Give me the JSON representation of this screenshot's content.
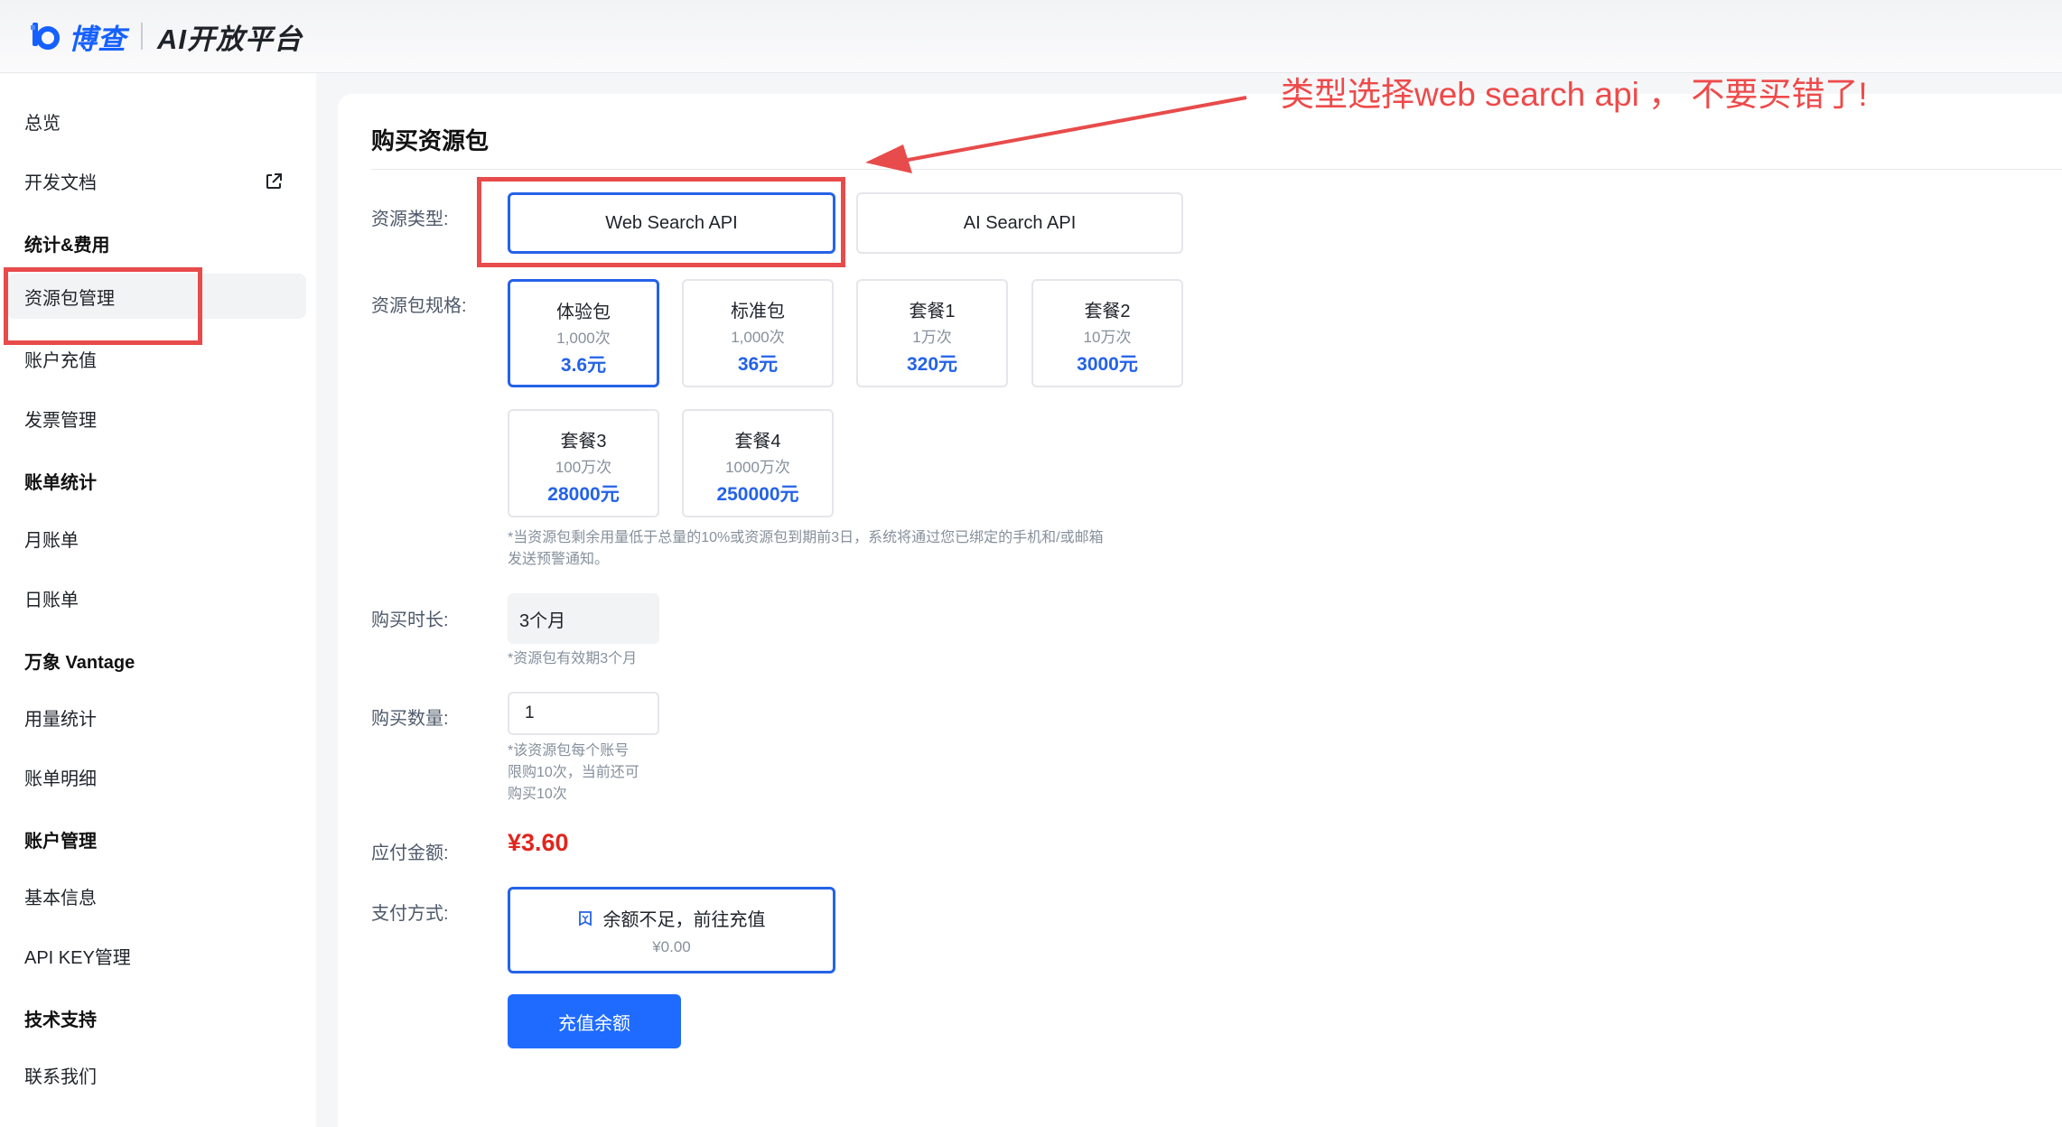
{
  "header": {
    "brand": "博查",
    "platform_title": "AI开放平台"
  },
  "sidebar": {
    "items": [
      {
        "label": "总览",
        "type": "item"
      },
      {
        "label": "开发文档",
        "type": "item",
        "external": true
      },
      {
        "label": "统计&费用",
        "type": "group"
      },
      {
        "label": "资源包管理",
        "type": "item",
        "active": true
      },
      {
        "label": "账户充值",
        "type": "item"
      },
      {
        "label": "发票管理",
        "type": "item"
      },
      {
        "label": "账单统计",
        "type": "group"
      },
      {
        "label": "月账单",
        "type": "item"
      },
      {
        "label": "日账单",
        "type": "item"
      },
      {
        "label": "万象 Vantage",
        "type": "group"
      },
      {
        "label": "用量统计",
        "type": "item"
      },
      {
        "label": "账单明细",
        "type": "item"
      },
      {
        "label": "账户管理",
        "type": "group"
      },
      {
        "label": "基本信息",
        "type": "item"
      },
      {
        "label": "API KEY管理",
        "type": "item"
      },
      {
        "label": "技术支持",
        "type": "group"
      },
      {
        "label": "联系我们",
        "type": "item"
      }
    ]
  },
  "main": {
    "title": "购买资源包",
    "resource_type": {
      "label": "资源类型:",
      "options": [
        {
          "label": "Web Search API",
          "selected": true
        },
        {
          "label": "AI Search API",
          "selected": false
        }
      ]
    },
    "spec": {
      "label": "资源包规格:",
      "packages": [
        {
          "name": "体验包",
          "count": "1,000次",
          "price": "3.6元",
          "selected": true
        },
        {
          "name": "标准包",
          "count": "1,000次",
          "price": "36元",
          "selected": false
        },
        {
          "name": "套餐1",
          "count": "1万次",
          "price": "320元",
          "selected": false
        },
        {
          "name": "套餐2",
          "count": "10万次",
          "price": "3000元",
          "selected": false
        },
        {
          "name": "套餐3",
          "count": "100万次",
          "price": "28000元",
          "selected": false
        },
        {
          "name": "套餐4",
          "count": "1000万次",
          "price": "250000元",
          "selected": false
        }
      ],
      "note_line1": "*当资源包剩余用量低于总量的10%或资源包到期前3日，系统将通过您已绑定的手机和/或邮箱",
      "note_line2": "发送预警通知。"
    },
    "duration": {
      "label": "购买时长:",
      "value": "3个月",
      "note": "*资源包有效期3个月"
    },
    "quantity": {
      "label": "购买数量:",
      "value": "1",
      "note_line1": "*该资源包每个账号",
      "note_line2": "限购10次，当前还可",
      "note_line3": "购买10次"
    },
    "amount": {
      "label": "应付金额:",
      "value": "¥3.60"
    },
    "payment": {
      "label": "支付方式:",
      "option_label": "余额不足，前往充值",
      "balance": "¥0.00"
    },
    "recharge_button": "充值余额"
  },
  "annotation": {
    "text": "类型选择web search api ， 不要买错了!",
    "color": "#ee4a4a"
  },
  "colors": {
    "accent": "#2462e8",
    "primary_button": "#1f6bff",
    "amount_red": "#e0261e"
  }
}
